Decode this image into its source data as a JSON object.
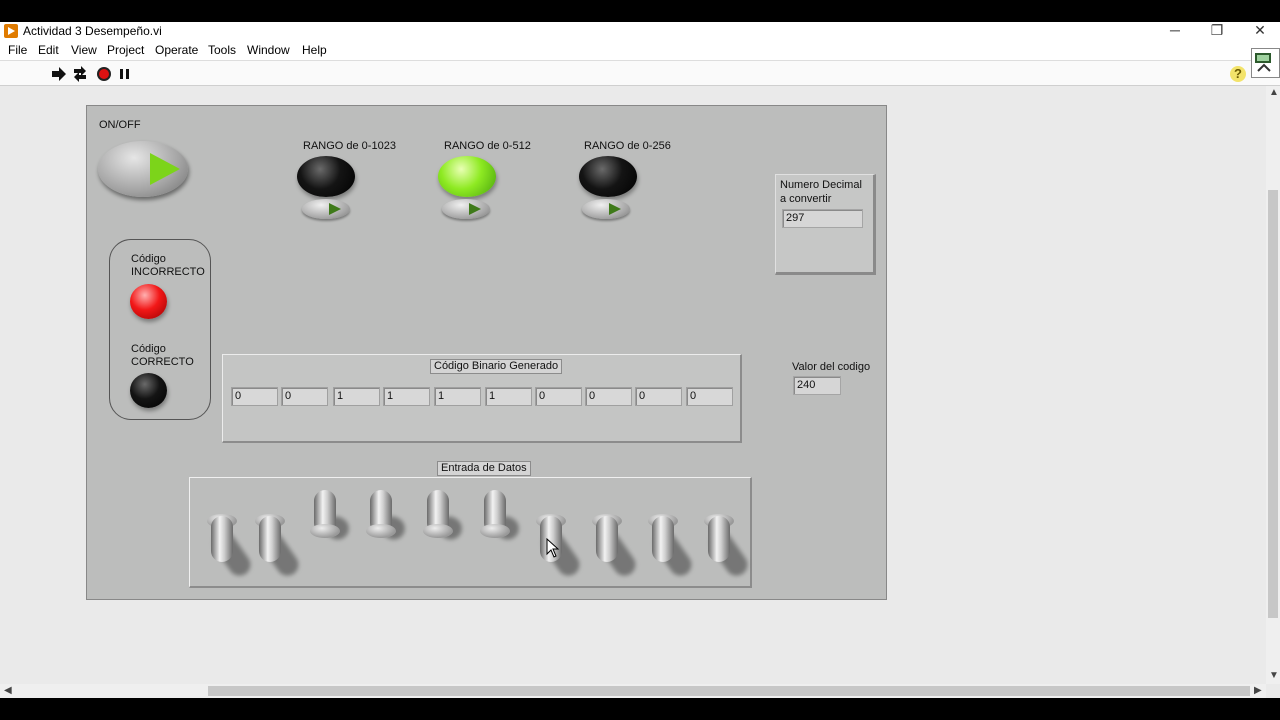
{
  "window": {
    "title": "Actividad 3 Desempeño.vi",
    "controls": {
      "minimize": "─",
      "restore": "❐",
      "close": "✕"
    }
  },
  "menu": [
    "File",
    "Edit",
    "View",
    "Project",
    "Operate",
    "Tools",
    "Window",
    "Help"
  ],
  "toolbar": {
    "buttons": [
      "run-arrow-icon",
      "run-continuously-icon",
      "abort-icon",
      "pause-icon"
    ],
    "help_label": "?"
  },
  "panel": {
    "onoff": {
      "label": "ON/OFF",
      "state": "on",
      "color": "#7cd41a"
    },
    "ranges": [
      {
        "label": "RANGO de 0-1023",
        "lit": false
      },
      {
        "label": "RANGO de 0-512",
        "lit": true,
        "color": "#8eea22"
      },
      {
        "label": "RANGO de 0-256",
        "lit": false
      }
    ],
    "status": {
      "incorrect_label_1": "Código",
      "incorrect_label_2": "INCORRECTO",
      "incorrect_lit": true,
      "incorrect_color": "#f21818",
      "correct_label_1": "Código",
      "correct_label_2": "CORRECTO",
      "correct_lit": false
    },
    "decimal": {
      "label_1": "Numero Decimal",
      "label_2": "a convertir",
      "value": "297"
    },
    "code_value": {
      "label": "Valor del codigo",
      "value": "240"
    },
    "binary": {
      "title": "Código Binario Generado",
      "bits": [
        "0",
        "0",
        "1",
        "1",
        "1",
        "1",
        "0",
        "0",
        "0",
        "0"
      ]
    },
    "switches": {
      "title": "Entrada de Datos",
      "states": [
        false,
        false,
        true,
        true,
        true,
        true,
        false,
        false,
        false,
        false
      ]
    }
  }
}
